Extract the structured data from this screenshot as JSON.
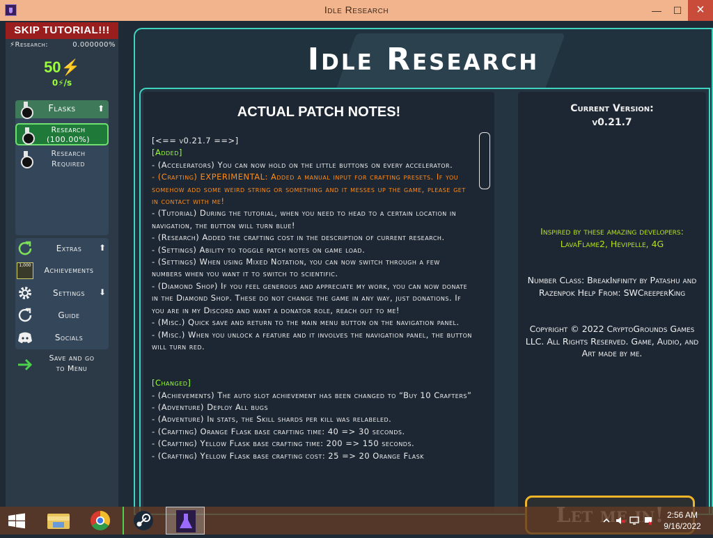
{
  "window": {
    "title": "Idle Research",
    "minimize": "—",
    "maximize": "☐",
    "close": "×"
  },
  "sidebar": {
    "skip_label": "SKIP TUTORIAL!!!",
    "research_label": "Research:",
    "research_value": "0.000000%",
    "energy": "50⚡",
    "energy_rate": "0⚡/s",
    "flasks_label": "Flasks",
    "research_item": {
      "line1": "Research",
      "line2": "(100.00%)"
    },
    "required_item": {
      "line1": "Research",
      "line2": "Required"
    },
    "extras_label": "Extras",
    "achievements_label": "Achievements",
    "achievements_badge": "1,000",
    "settings_label": "Settings",
    "guide_label": "Guide",
    "socials_label": "Socials",
    "save_menu": {
      "line1": "Save and go",
      "line2": "to Menu"
    },
    "arrows": {
      "up": "⬆",
      "down": "⬇"
    }
  },
  "main": {
    "title": "Idle Research",
    "notes_heading": "ACTUAL PATCH NOTES!",
    "notes": [
      {
        "type": "text",
        "text": "[<== v0.21.7 ==>]"
      },
      {
        "type": "hd",
        "text": "[Added]"
      },
      {
        "type": "text",
        "text": "- (Accelerators) You can now hold on the little buttons on every accelerator."
      },
      {
        "type": "ex",
        "text": "- (Crafting) EXPERIMENTAL: Added a manual input for crafting presets. If you somehow add some weird string or something and it messes up the game, please get in contact with me!"
      },
      {
        "type": "text",
        "text": "- (Tutorial) During the tutorial, when you need to head to a certain location in navigation, the button will turn blue!"
      },
      {
        "type": "text",
        "text": "- (Research) Added the crafting cost in the description of current research."
      },
      {
        "type": "text",
        "text": "- (Settings) Ability to toggle patch notes on game load."
      },
      {
        "type": "text",
        "text": "- (Settings) When using Mixed Notation, you can now switch through a few numbers when you want it to switch to scientific."
      },
      {
        "type": "text",
        "text": "- (Diamond Shop) If you feel generous and appreciate my work, you can now donate in the Diamond Shop. These do not change the game in any way, just donations. If you are in my Discord and want a donator role, reach out to me!"
      },
      {
        "type": "text",
        "text": "- (Misc.) Quick save and return to the main menu button on the navigation panel."
      },
      {
        "type": "text",
        "text": "- (Misc.) When you unlock a feature and it involves the navigation panel, the button will turn red."
      },
      {
        "type": "blank",
        "text": ""
      },
      {
        "type": "blank",
        "text": ""
      },
      {
        "type": "hd",
        "text": "[Changed]"
      },
      {
        "type": "text",
        "text": "- (Achievements) The auto slot achievement has been changed to “Buy 10 Crafters”"
      },
      {
        "type": "text",
        "text": "- (Adventure) Deploy All bugs"
      },
      {
        "type": "text",
        "text": "- (Adventure) In stats, the Skill shards per kill was relabeled."
      },
      {
        "type": "text",
        "text": "- (Crafting) Orange Flask base crafting time: 40 => 30 seconds."
      },
      {
        "type": "text",
        "text": "- (Crafting) Yellow Flask base crafting time: 200 => 150 seconds."
      },
      {
        "type": "text",
        "text": "- (Crafting) Yellow Flask base crafting cost: 25 => 20 Orange Flask"
      }
    ],
    "version_label": "Current Version:",
    "version_value": "v0.21.7",
    "inspired": "Inspired by these amazing developers: LavaFlame2, Hevipelle, 4G",
    "number_class": "Number Class: BreakInfinity by Patashu and Razenpok Help From: SWCreeperKing",
    "copyright": "Copyright © 2022 CryptoGrounds Games LLC. All Rights Reserved. Game, Audio, and Art made by me.",
    "letmein": "Let me in!"
  },
  "taskbar": {
    "apps": [
      "start-icon",
      "file-explorer-icon",
      "chrome-icon",
      "steam-icon",
      "idle-research-icon"
    ],
    "time": "2:56 AM",
    "date": "9/16/2022"
  },
  "colors": {
    "accent": "#3fd4c0",
    "energy": "#9aff3a",
    "skip": "#9a1e1e",
    "experimental": "#ff8c1a",
    "inspired": "#b8e020",
    "letmein_border": "#f0b428"
  }
}
